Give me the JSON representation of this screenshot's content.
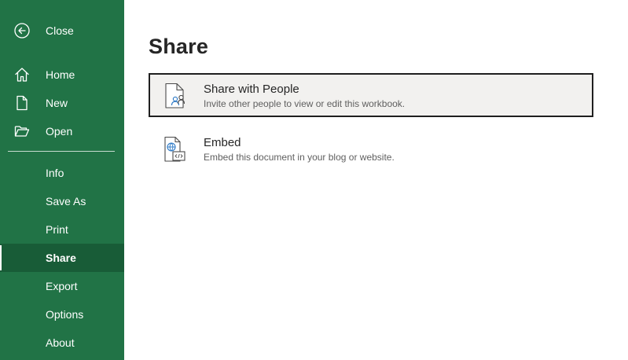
{
  "sidebar": {
    "close_label": "Close",
    "items": [
      {
        "label": "Home",
        "icon": "home-icon"
      },
      {
        "label": "New",
        "icon": "new-document-icon"
      },
      {
        "label": "Open",
        "icon": "open-folder-icon"
      }
    ],
    "secondary_items": [
      {
        "label": "Info"
      },
      {
        "label": "Save As"
      },
      {
        "label": "Print"
      },
      {
        "label": "Share",
        "selected": true
      },
      {
        "label": "Export"
      },
      {
        "label": "Options"
      },
      {
        "label": "About"
      }
    ]
  },
  "main": {
    "title": "Share",
    "options": [
      {
        "title": "Share with People",
        "description": "Invite other people to view or edit this workbook.",
        "icon": "share-with-people-icon"
      },
      {
        "title": "Embed",
        "description": "Embed this document in your blog or website.",
        "icon": "embed-icon"
      }
    ]
  },
  "colors": {
    "sidebar_bg": "#217346",
    "sidebar_selected_bg": "#185c37",
    "focus_border": "#1f1f1f",
    "accent_blue": "#2b78c5"
  }
}
